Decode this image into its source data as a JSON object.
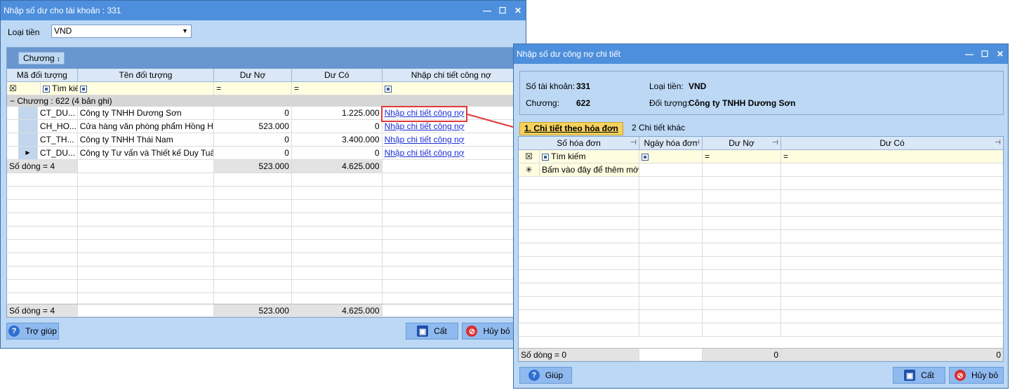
{
  "main_window": {
    "title": "Nhập số dư cho tài khoản : 331",
    "currency_label": "Loại tiền",
    "currency_value": "VND",
    "group_panel_label": "Chương",
    "columns": [
      "Mã đối tượng",
      "Tên đối tượng",
      "Dư Nợ",
      "Dư Có",
      "Nhập chi tiết công nợ"
    ],
    "search_label": "Tìm kiếm",
    "group_label": "Chương : 622 (4 bản ghi)",
    "rows": [
      {
        "code": "CT_DU...",
        "name": "Công ty TNHH Dương Sơn",
        "debit": "0",
        "credit": "1.225.000",
        "link": "Nhập chi tiết công nợ"
      },
      {
        "code": "CH_HO...",
        "name": "Cửa hàng văn phòng phẩm Hồng Hà",
        "debit": "523.000",
        "credit": "0",
        "link": "Nhập chi tiết công nợ"
      },
      {
        "code": "CT_TH...",
        "name": "Công ty TNHH Thái Nam",
        "debit": "0",
        "credit": "3.400.000",
        "link": "Nhập chi tiết công nợ"
      },
      {
        "code": "CT_DU...",
        "name": "Công ty Tư vấn và Thiết kế Duy Tuấn",
        "debit": "0",
        "credit": "0",
        "link": "Nhập chi tiết công nợ"
      }
    ],
    "group_summary": {
      "count": "Số dòng = 4",
      "debit": "523.000",
      "credit": "4.625.000"
    },
    "footer_summary": {
      "count": "Số dòng = 4",
      "debit": "523.000",
      "credit": "4.625.000"
    },
    "help_button": "Trợ giúp",
    "save_button": "Cất",
    "cancel_button": "Hủy bỏ"
  },
  "detail_window": {
    "title": "Nhập số dư công nợ chi tiết",
    "account_label": "Số tài khoản:",
    "account_value": "331",
    "currency_label": "Loại tiền:",
    "currency_value": "VND",
    "chapter_label": "Chương:",
    "chapter_value": "622",
    "object_label": "Đối tượng:",
    "object_value": "Công ty TNHH Dương Sơn",
    "tab1": "1. Chi tiết theo hóa đơn",
    "tab2": "2 Chi tiết khác",
    "columns": [
      "Số hóa đơn",
      "Ngày hóa đơn",
      "Dư Nợ",
      "Dư Có"
    ],
    "search_label": "Tìm kiếm",
    "new_row_label": "Bấm vào đây để thêm mới",
    "footer_count": "Số dòng = 0",
    "footer_debit": "0",
    "footer_credit": "0",
    "help_button": "Giúp",
    "save_button": "Cất",
    "cancel_button": "Hủy bỏ"
  }
}
